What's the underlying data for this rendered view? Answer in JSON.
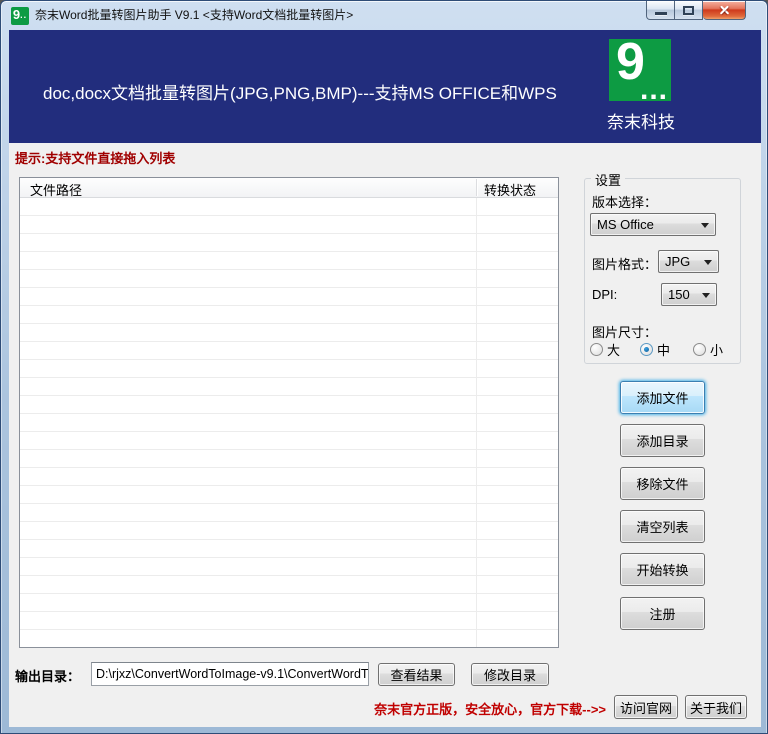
{
  "window": {
    "title": "奈末Word批量转图片助手 V9.1 <支持Word文档批量转图片>"
  },
  "header": {
    "banner_text": "doc,docx文档批量转图片(JPG,PNG,BMP)---支持MS OFFICE和WPS",
    "logo_glyph": "9",
    "logo_dots": "...",
    "logo_caption": "奈末科技"
  },
  "hint": "提示:支持文件直接拖入列表",
  "file_table": {
    "columns": [
      "文件路径",
      "转换状态"
    ],
    "rows": []
  },
  "settings": {
    "group_label": "设置",
    "version_label": "版本选择：",
    "version_value": "MS Office",
    "format_label": "图片格式：",
    "format_value": "JPG",
    "dpi_label": "DPI:",
    "dpi_value": "150",
    "size_label": "图片尺寸：",
    "size_options": [
      {
        "label": "大",
        "selected": false
      },
      {
        "label": "中",
        "selected": true
      },
      {
        "label": "小",
        "selected": false
      }
    ]
  },
  "action_buttons": [
    {
      "label": "添加文件",
      "focused": true
    },
    {
      "label": "添加目录",
      "focused": false
    },
    {
      "label": "移除文件",
      "focused": false
    },
    {
      "label": "清空列表",
      "focused": false
    },
    {
      "label": "开始转换",
      "focused": false
    },
    {
      "label": "注册",
      "focused": false
    }
  ],
  "output": {
    "label": "输出目录：",
    "path": "D:\\rjxz\\ConvertWordToImage-v9.1\\ConvertWordT",
    "view_button": "查看结果",
    "modify_button": "修改目录"
  },
  "footer": {
    "promo_text": "奈末官方正版，安全放心，官方下载-->>",
    "website_button": "访问官网",
    "about_button": "关于我们"
  },
  "colors": {
    "banner_blue": "#222d7d",
    "logo_green": "#0d9b43",
    "hint_red": "#a00000",
    "promo_red": "#c00000",
    "focus_blue": "#3c7fb1"
  }
}
